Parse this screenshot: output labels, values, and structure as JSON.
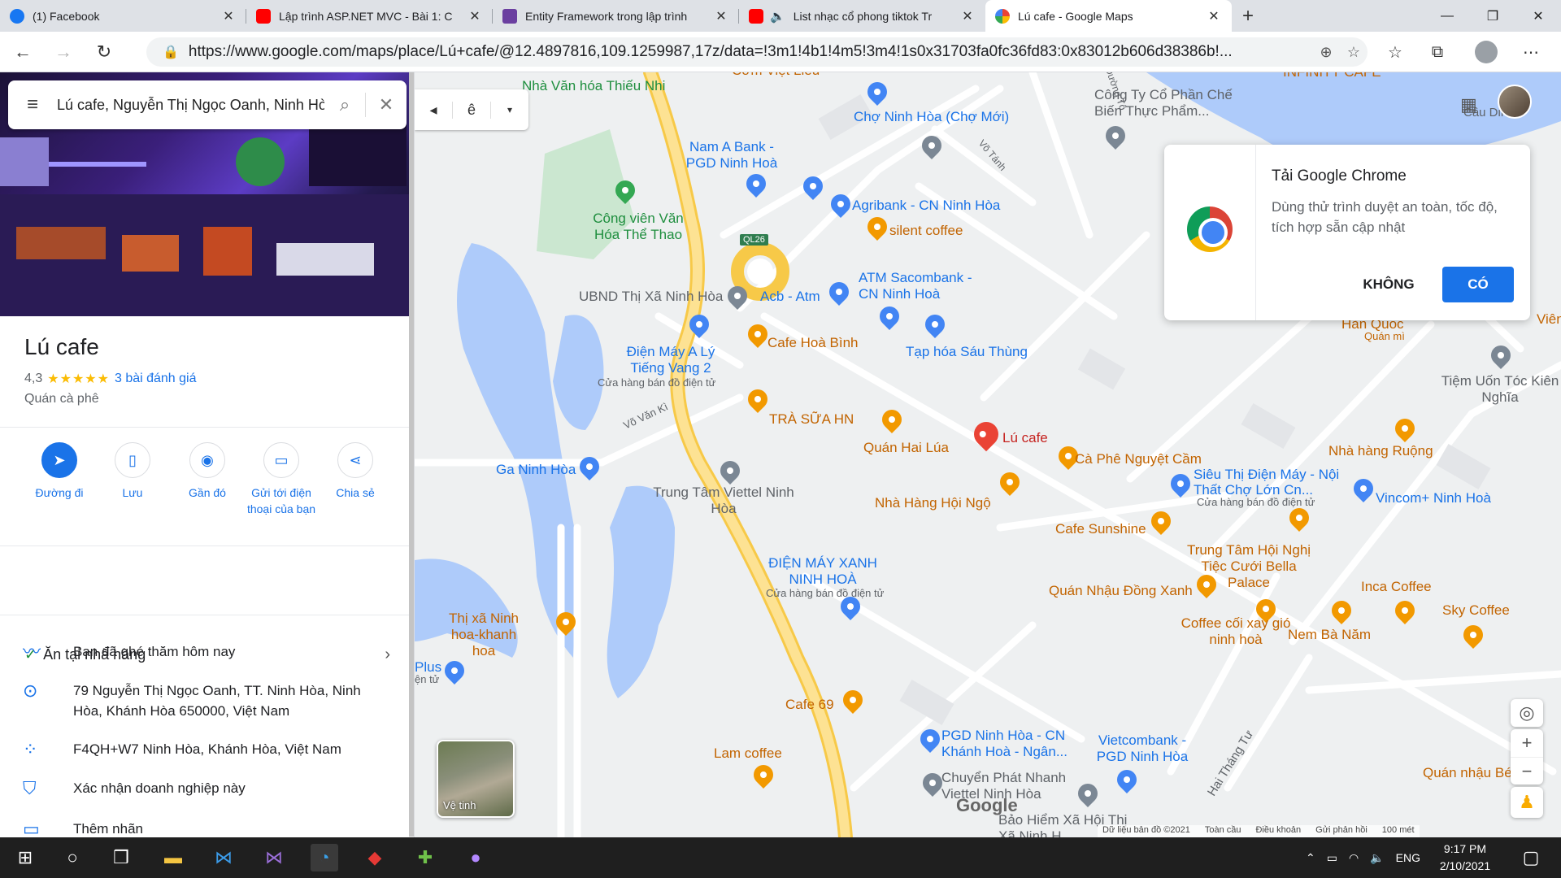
{
  "browser": {
    "tabs": [
      {
        "title": "(1) Facebook",
        "favicon": "facebook-icon",
        "color": "#1877f2",
        "active": false
      },
      {
        "title": "Lập trình ASP.NET MVC - Bài 1: C",
        "favicon": "youtube-icon",
        "color": "#ff0000",
        "active": false
      },
      {
        "title": "Entity Framework trong lập trình",
        "favicon": "page-icon",
        "color": "#6b3fa0",
        "active": false
      },
      {
        "title": "List nhạc cổ phong tiktok Tr",
        "favicon": "youtube-icon",
        "color": "#ff0000",
        "active": false
      },
      {
        "title": "Lú cafe - Google Maps",
        "favicon": "maps-icon",
        "color": "#34a853",
        "active": true
      }
    ],
    "url": "https://www.google.com/maps/place/Lú+cafe/@12.4897816,109.1259987,17z/data=!3m1!4b1!4m5!3m4!1s0x31703fa0fc36fd83:0x83012b606d38386b!..."
  },
  "search": {
    "query": "Lú cafe, Nguyễn Thị Ngọc Oanh, Ninh Hòa"
  },
  "place": {
    "name": "Lú cafe",
    "rating": "4,3",
    "stars": "★★★★★",
    "reviews": "3 bài đánh giá",
    "category": "Quán cà phê",
    "actions": [
      {
        "label": "Đường đi",
        "icon": "directions-icon"
      },
      {
        "label": "Lưu",
        "icon": "bookmark-icon"
      },
      {
        "label": "Gần đó",
        "icon": "nearby-icon"
      },
      {
        "label": "Gửi tới điện thoại của bạn",
        "icon": "send-to-phone-icon"
      },
      {
        "label": "Chia sẻ",
        "icon": "share-icon"
      }
    ],
    "dine_in": "Ăn tại nhà hàng",
    "visited": "Bạn đã ghé thăm hôm nay",
    "address": "79 Nguyễn Thị Ngọc Oanh, TT. Ninh Hòa, Ninh Hòa, Khánh Hòa 650000, Việt Nam",
    "plus_code": "F4QH+W7 Ninh Hòa, Khánh Hòa, Việt Nam",
    "claim": "Xác nhận doanh nghiệp này",
    "add_label": "Thêm nhãn"
  },
  "map": {
    "satellite_label": "Vệ tinh",
    "layer_letter": "ê",
    "selected_place": "Lú cafe",
    "labels": {
      "nha_van_hoa": "Nhà Văn hóa Thiếu Nhi",
      "com_viet_lieu": "Cơm Việt Liêu",
      "infinity": "INFINITY CAFE",
      "cong_ty": "Công Ty Cổ Phần Chế Biến Thực Phẩm...",
      "cho_ninh_hoa": "Chợ Ninh Hòa (Chợ Mới)",
      "nam_a_bank": "Nam A Bank - PGD Ninh Hoà",
      "agribank": "Agribank - CN Ninh Hòa",
      "silent": "silent coffee",
      "cong_vien": "Công viên Văn Hóa Thể Thao",
      "ql26": "QL26",
      "ubnd": "UBND Thị Xã Ninh Hòa",
      "acb": "Acb - Atm",
      "atm_sacombank": "ATM Sacombank - CN Ninh Hoà",
      "dien_may_aly": "Điện Máy A Lý Tiếng Vang 2",
      "dien_may_sub": "Cửa hàng bán đồ điện tử",
      "cafe_hoa_binh": "Cafe Hoà Bình",
      "tap_hoa": "Tạp hóa Sáu Thùng",
      "vo_van_ki": "Võ Văn Kì",
      "tra_sua": "TRÀ SỮA HN",
      "quan_hai_lua": "Quán Hai Lúa",
      "ca_phe_nguyet_cam": "Cà Phê Nguyệt Cầm",
      "ga_ninh_hoa": "Ga Ninh Hòa",
      "trung_tam_viettel": "Trung Tâm Viettel Ninh Hòa",
      "nha_hang_hoi_ngo": "Nhà Hàng Hội Ngộ",
      "sieu_thi": "Siêu Thị Điện Máy - Nội Thất Chợ Lớn Cn...",
      "sieu_thi_sub": "Cửa hàng bán đồ điện tử",
      "vincom": "Vincom+ Ninh Hoà",
      "cafe_sunshine": "Cafe Sunshine",
      "trung_tam_hoi_nghi": "Trung Tâm Hội Nghị Tiệc Cưới Bella Palace",
      "dien_may_xanh": "ĐIỆN MÁY XANH NINH HOÀ",
      "dien_may_xanh_sub": "Cửa hàng bán đồ điện tử",
      "quan_nhau_dong_xanh": "Quán Nhậu Đồng Xanh",
      "inca": "Inca Coffee",
      "sky": "Sky Coffee",
      "thi_xa": "Thị xã Ninh hoa-khanh hoa",
      "coffee_coi_xay": "Coffee cối xay gió ninh hoà",
      "nem_ba_nam": "Nem Bà Năm",
      "cafe_69": "Cafe 69",
      "lam_coffee": "Lam coffee",
      "pgd_ninh_hoa": "PGD Ninh Hòa - CN Khánh Hoà - Ngân...",
      "vietcombank": "Vietcombank - PGD Ninh Hòa",
      "chuyen_phat": "Chuyển Phát Nhanh Viettel Ninh Hòa",
      "bao_hiem": "Bảo Hiểm Xã Hội Thị Xã Ninh H...",
      "quan_nhau_be": "Quán nhậu Bé",
      "hai_thang_tu": "Hai Tháng Tư",
      "han_quoc": "Hàn Quốc",
      "quan_mi": "Quán mì",
      "tiem_uon_toc": "Tiệm Uốn Tóc Kiên Nghĩa",
      "nha_hang_ruong": "Nhà hàng Ruộng",
      "vien": "Viên",
      "cau_dinh": "Cầu Dinh",
      "plus": "Plus",
      "plus_sub": "ện tử",
      "vo_tanh": "Võ Tánh",
      "duong_to": "Đường Tô"
    },
    "footer": {
      "copyright": "Dữ liệu bản đồ ©2021",
      "global": "Toàn cầu",
      "terms": "Điều khoản",
      "feedback": "Gửi phản hồi",
      "scale": "100 mét"
    },
    "logo": "Google"
  },
  "chrome_popup": {
    "title": "Tải Google Chrome",
    "body": "Dùng thử trình duyệt an toàn, tốc độ, tích hợp sẵn cập nhật",
    "no": "KHÔNG",
    "yes": "CÓ"
  },
  "taskbar": {
    "lang": "ENG",
    "time": "9:17 PM",
    "date": "2/10/2021"
  }
}
